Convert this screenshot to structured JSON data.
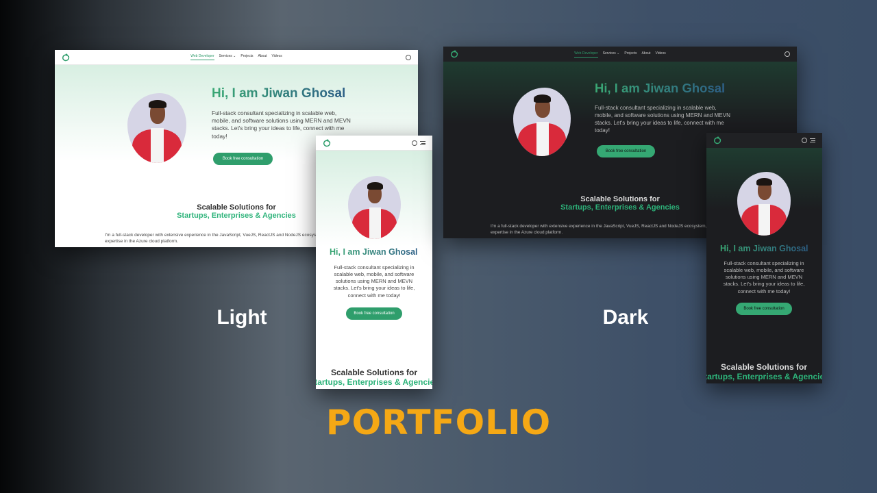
{
  "nav": {
    "items": [
      "Web Developer",
      "Services ⌄",
      "Projects",
      "About",
      "Videos"
    ]
  },
  "hero": {
    "title": "Hi, I am Jiwan Ghosal",
    "desc": "Full-stack consultant specializing in scalable web, mobile, and software solutions using MERN and MEVN stacks. Let's bring your ideas to life, connect with me today!",
    "cta": "Book free consultation"
  },
  "section": {
    "line1": "Scalable Solutions for",
    "line2": "Startups, Enterprises & Agencies",
    "para1": "I'm a full-stack developer with extensive experience in the JavaScript, VueJS, ReactJS and NodeJS ecosystem,",
    "para2": "expertise in the Azure cloud platform."
  },
  "labels": {
    "light": "Light",
    "dark": "Dark",
    "headline": "PORTFOLIO"
  },
  "colors": {
    "accent": "#2f9e6c",
    "headline": "#f5a815"
  }
}
